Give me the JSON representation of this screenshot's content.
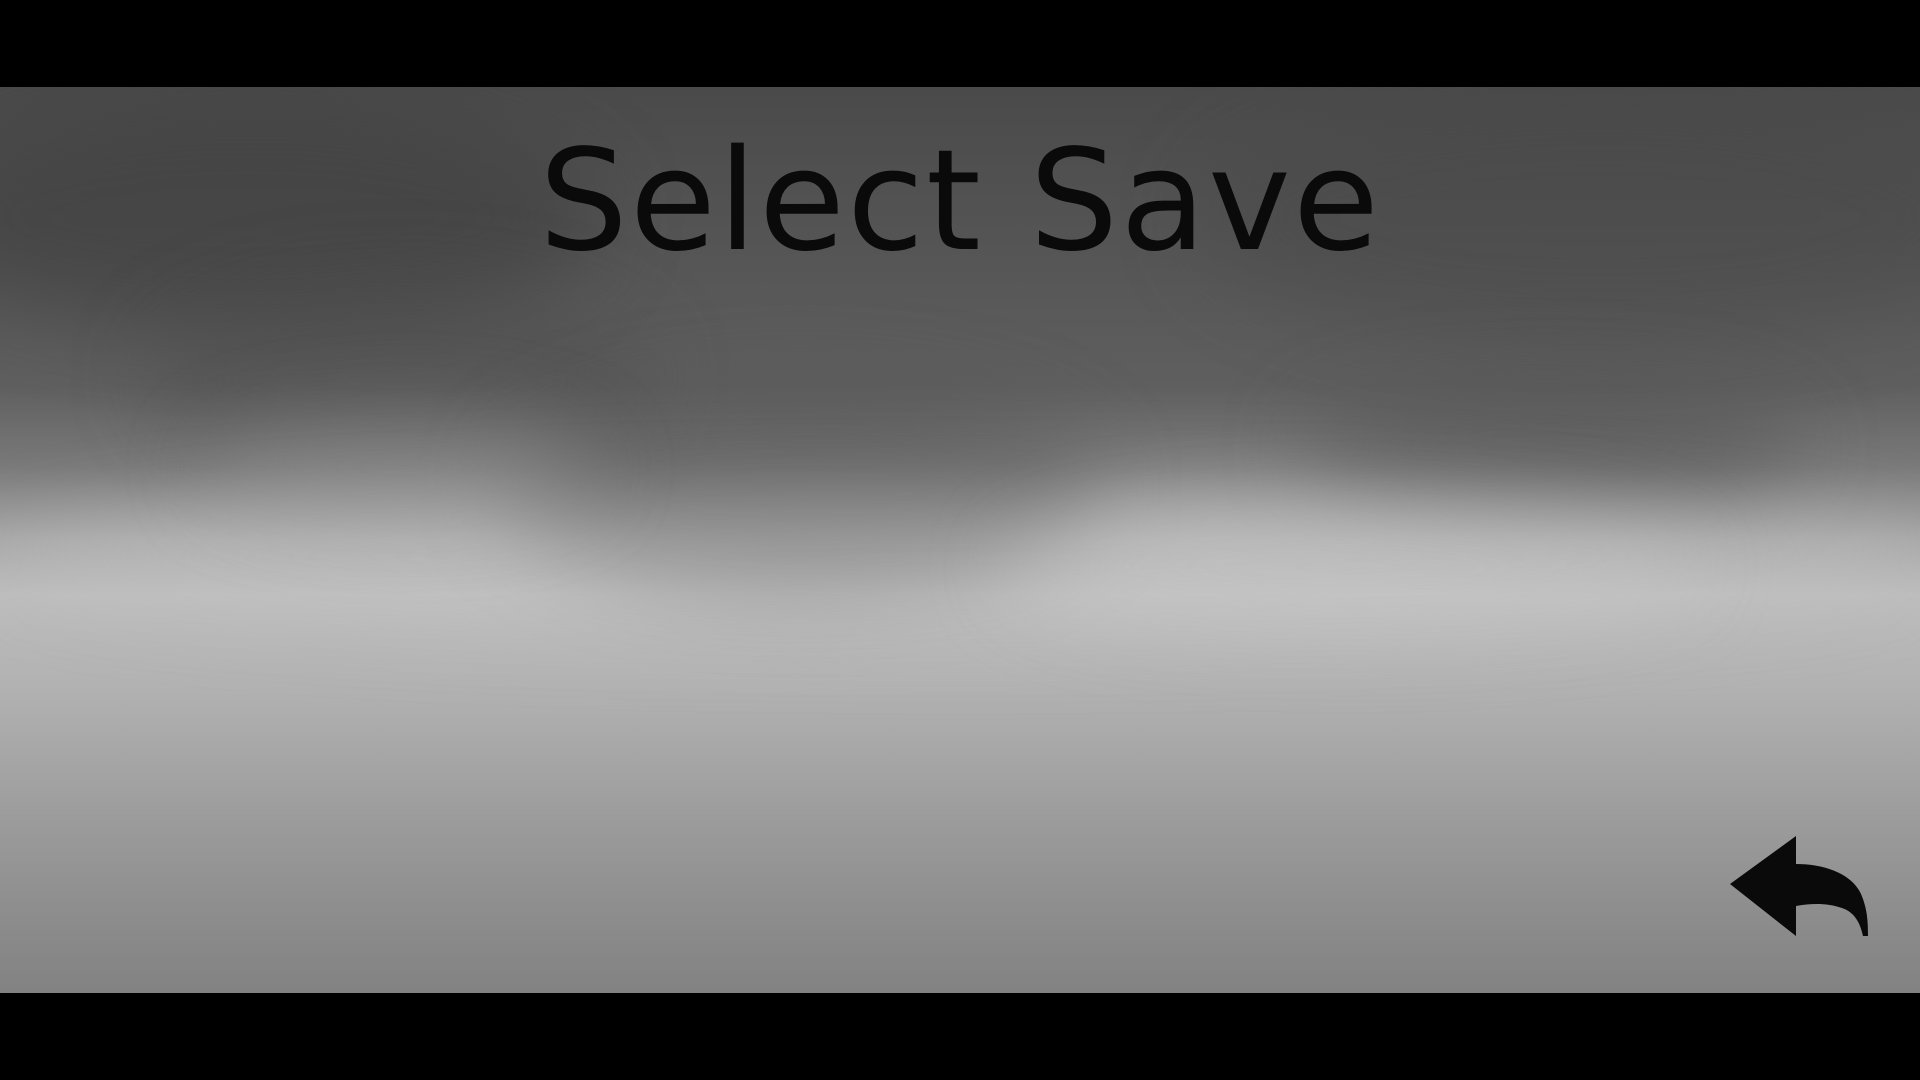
{
  "screen": {
    "title": "Select Save"
  },
  "back_button": {
    "icon": "back-arrow-icon",
    "color": "#0a0a0a"
  },
  "colors": {
    "letterbox": "#000000",
    "sky_top": "#4a4a4a",
    "sky_horizon": "#bdbdbd",
    "title_text": "#0a0a0a"
  }
}
